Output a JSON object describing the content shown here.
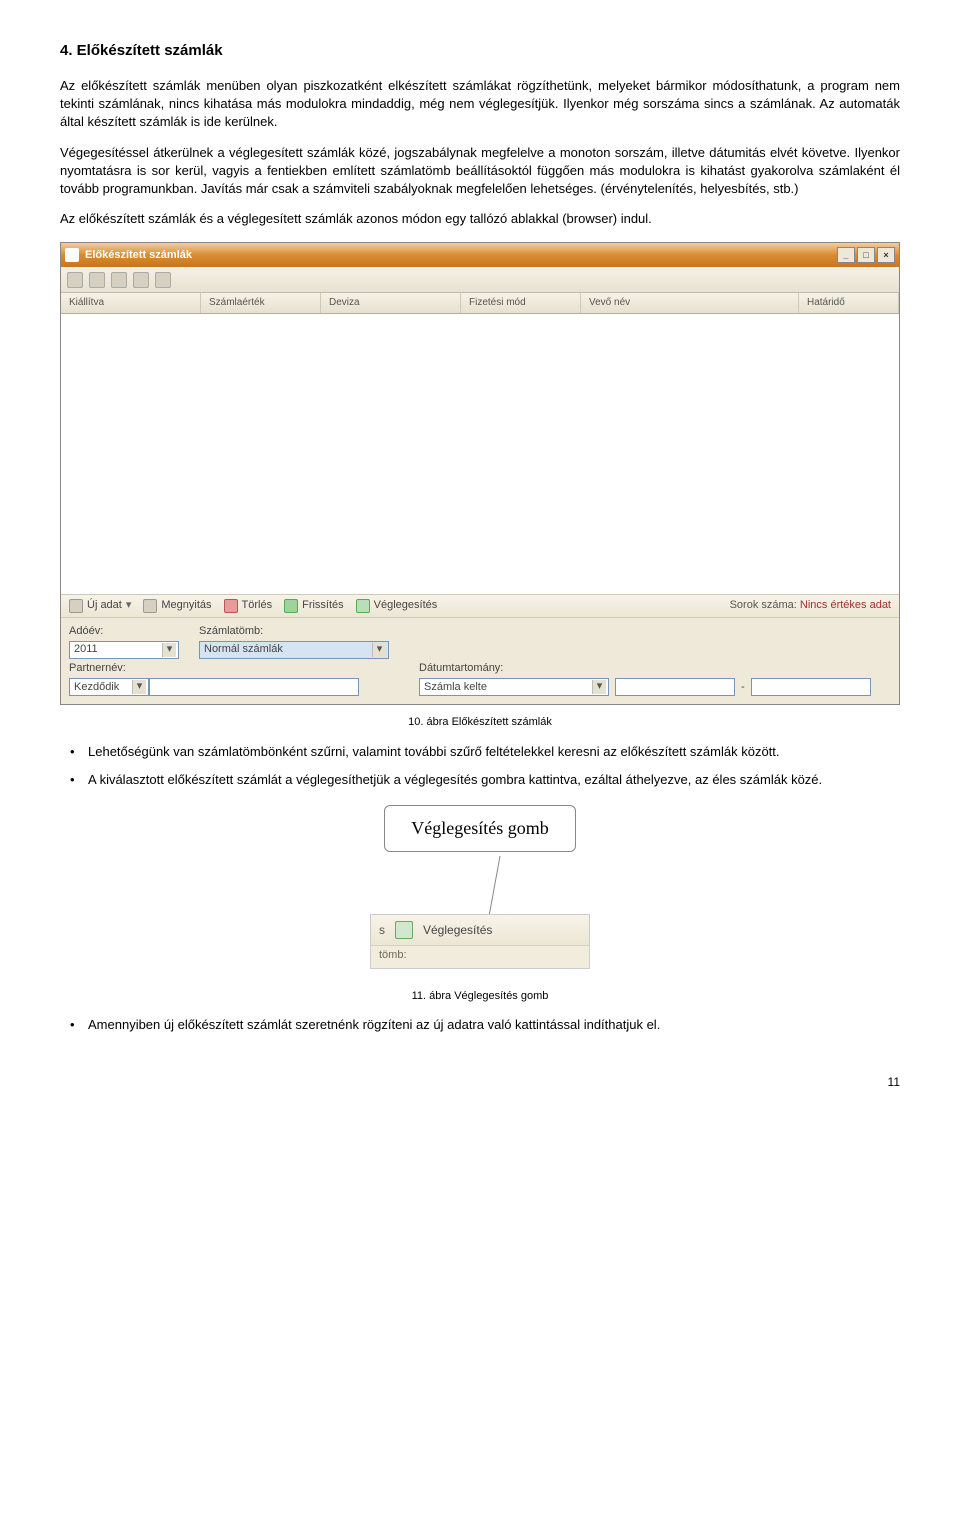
{
  "heading": "4. Előkészített számlák",
  "paragraphs": {
    "p1": "Az előkészített számlák menüben olyan piszkozatként elkészített számlákat rögzíthetünk, melyeket bármikor módosíthatunk, a program nem tekinti számlának, nincs kihatása más modulokra mindaddig, még nem véglegesítjük. Ilyenkor még sorszáma sincs a számlának. Az automaták által készített számlák is ide kerülnek.",
    "p2": "Végegesítéssel átkerülnek a véglegesített számlák közé, jogszabálynak megfelelve a monoton sorszám, illetve dátumitás elvét követve. Ilyenkor nyomtatásra is sor kerül, vagyis a fentiekben említett számlatömb beállításoktól függően más modulokra is kihatást gyakorolva számlaként él tovább programunkban. Javítás már csak a számviteli szabályoknak megfelelően lehetséges. (érvénytelenítés, helyesbítés, stb.)",
    "p3": "Az előkészített számlák és a véglegesített számlák azonos módon egy tallózó ablakkal (browser) indul."
  },
  "window": {
    "title": "Előkészített számlák",
    "columns": {
      "kiallitva": "Kiállítva",
      "szamlaertek": "Számlaérték",
      "deviza": "Deviza",
      "fizmod": "Fizetési mód",
      "vevo": "Vevő név",
      "hatarido": "Határidő"
    },
    "actions": {
      "uj": "Új adat",
      "megnyitas": "Megnyitás",
      "torles": "Törlés",
      "frissites": "Frissítés",
      "veglegesites": "Véglegesítés",
      "sorok_label": "Sorok száma:",
      "sorok_value": "Nincs értékes adat"
    },
    "filters": {
      "adoev_label": "Adóév:",
      "adoev_value": "2011",
      "tomb_label": "Számlatömb:",
      "tomb_value": "Normál számlák",
      "partner_label": "Partnernév:",
      "partner_value": "Kezdődik",
      "datum_label": "Dátumtartomány:",
      "datum_value": "Számla kelte",
      "dash": "-"
    }
  },
  "caption1": "10. ábra Előkészített számlák",
  "bullets": {
    "b1": "Lehetőségünk van számlatömbönként szűrni, valamint további szűrő feltételekkel keresni az előkészített számlák között.",
    "b2": "A kiválasztott előkészített számlát a véglegesíthetjük a véglegesítés gombra kattintva, ezáltal áthelyezve, az éles számlák közé."
  },
  "callout": "Véglegesítés gomb",
  "crop": {
    "s": "s",
    "label": "Véglegesítés",
    "sub": "tömb:"
  },
  "caption2": "11. ábra Véglegesítés gomb",
  "bullets2": {
    "b1": "Amennyiben új előkészített számlát szeretnénk rögzíteni az új adatra való kattintással indíthatjuk el."
  },
  "page_number": "11"
}
